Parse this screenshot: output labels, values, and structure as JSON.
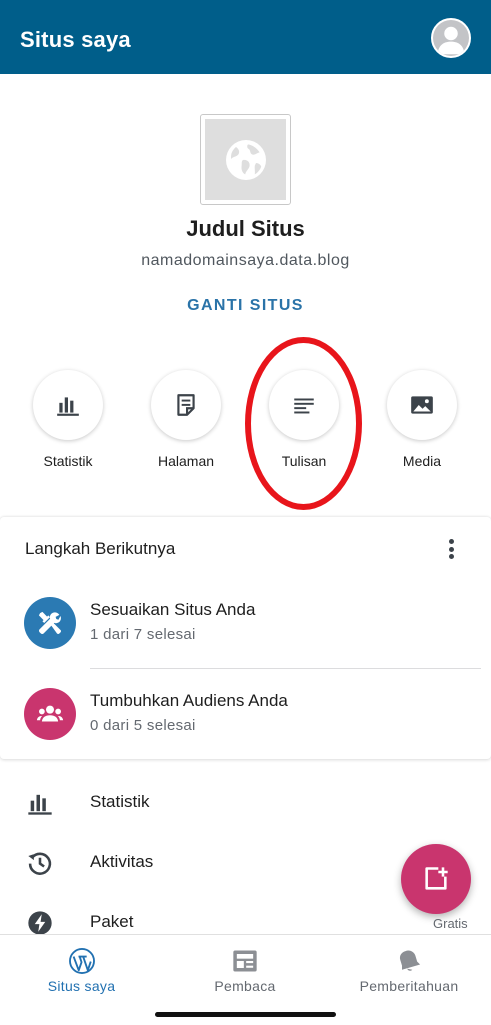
{
  "appbar": {
    "title": "Situs saya"
  },
  "site": {
    "title": "Judul Situs",
    "url": "namadomainsaya.data.blog",
    "switch_label": "GANTI SITUS"
  },
  "quick_actions": [
    {
      "label": "Statistik",
      "icon": "bar-chart-icon"
    },
    {
      "label": "Halaman",
      "icon": "page-icon"
    },
    {
      "label": "Tulisan",
      "icon": "posts-icon"
    },
    {
      "label": "Media",
      "icon": "image-icon"
    }
  ],
  "next_steps": {
    "title": "Langkah Berikutnya",
    "tasks": [
      {
        "title": "Sesuaikan Situs Anda",
        "subtitle": "1 dari 7 selesai",
        "icon": "tools-icon",
        "color": "#2b7ab3"
      },
      {
        "title": "Tumbuhkan Audiens Anda",
        "subtitle": "0 dari 5 selesai",
        "icon": "people-icon",
        "color": "#c9356e"
      }
    ]
  },
  "menu": [
    {
      "label": "Statistik",
      "icon": "bar-chart-icon"
    },
    {
      "label": "Aktivitas",
      "icon": "history-icon"
    },
    {
      "label": "Paket",
      "icon": "plan-icon"
    }
  ],
  "fab": {
    "badge": "Gratis",
    "color": "#c9356e"
  },
  "bottom_nav": [
    {
      "label": "Situs saya",
      "icon": "wordpress-icon",
      "active": true
    },
    {
      "label": "Pembaca",
      "icon": "reader-icon",
      "active": false
    },
    {
      "label": "Pemberitahuan",
      "icon": "bell-icon",
      "active": false
    }
  ],
  "colors": {
    "appbar": "#005e8a",
    "accent": "#2a73a8",
    "active_nav": "#2271b1",
    "inactive_nav": "#646970",
    "annotation": "#e8151b"
  }
}
